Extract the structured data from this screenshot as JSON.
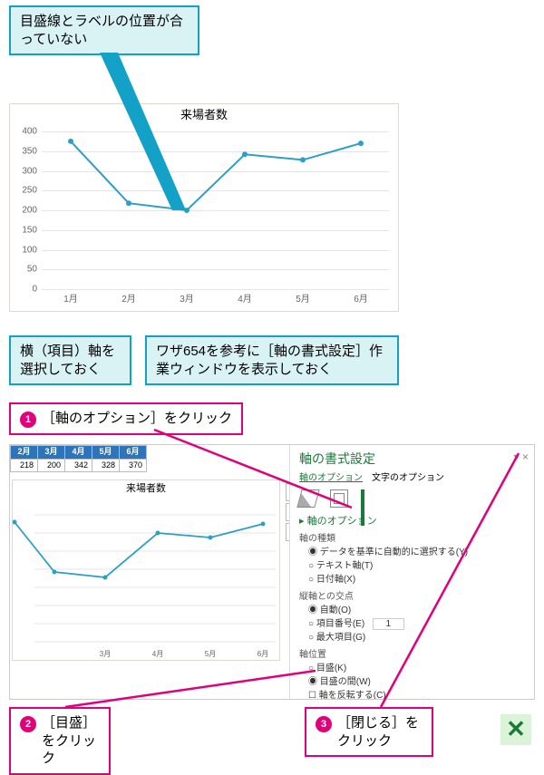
{
  "callout1": "目盛線とラベルの位置が合っていない",
  "callout2": "横（項目）軸を選択しておく",
  "callout3": "ワザ654を参考に［軸の書式設定］作業ウィンドウを表示しておく",
  "step1": "［軸のオプション］をクリック",
  "step2": "［目盛］をクリック",
  "step3": "［閉じる］をクリック",
  "badge1": "1",
  "badge2": "2",
  "badge3": "3",
  "pane_title": "軸の書式設定",
  "pane_tab1": "軸のオプション",
  "pane_tab2": "文字のオプション",
  "sec_axisopt": "軸のオプション",
  "grp_type": "軸の種類",
  "opt_auto": "データを基準に自動的に選択する(Y)",
  "opt_text": "テキスト軸(T)",
  "opt_date": "日付軸(X)",
  "grp_cross": "縦軸との交点",
  "opt_c_auto": "自動(O)",
  "opt_c_item": "項目番号(E)",
  "opt_c_max": "最大項目(G)",
  "item_num_val": "1",
  "grp_pos": "軸位置",
  "opt_p_tick": "目盛(K)",
  "opt_p_between": "目盛の間(W)",
  "opt_reverse": "軸を反転する(C)",
  "vtool_add": "+",
  "vtool_brush": "✎",
  "vtool_filter": "▾",
  "pane_close": "▾  ×",
  "chart_data": {
    "type": "line",
    "title": "来場者数",
    "categories": [
      "1月",
      "2月",
      "3月",
      "4月",
      "5月",
      "6月"
    ],
    "values": [
      375,
      218,
      200,
      342,
      328,
      370
    ],
    "ylim": [
      0,
      400
    ],
    "ystep": 50
  },
  "table_head": [
    "2月",
    "3月",
    "4月",
    "5月",
    "6月"
  ],
  "table_row": [
    "218",
    "200",
    "342",
    "328",
    "370"
  ]
}
